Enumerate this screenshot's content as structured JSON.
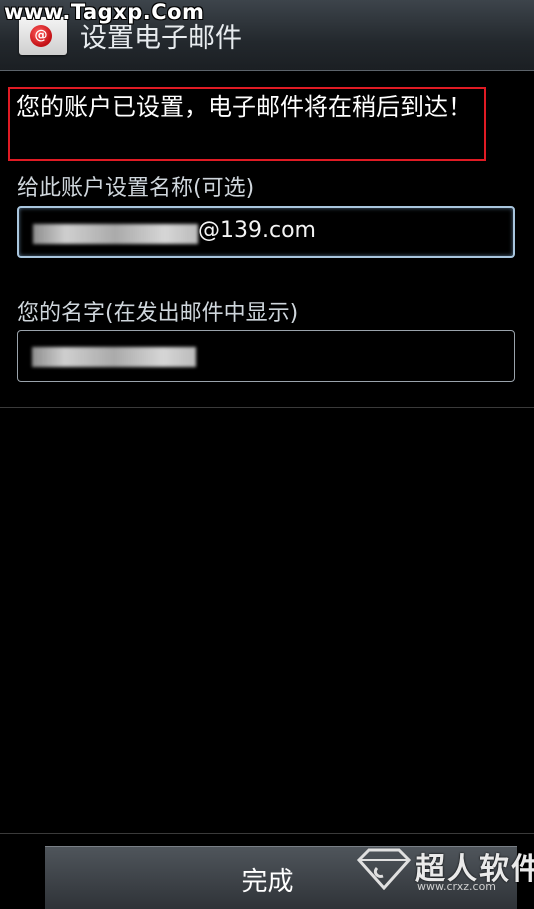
{
  "watermark": {
    "site": "www.Tagxp.Com"
  },
  "header": {
    "title": "设置电子邮件",
    "icon": "email-app-icon"
  },
  "notice": {
    "text": "您的账户已设置，电子邮件将在稍后到达！"
  },
  "fields": [
    {
      "label": "给此账户设置名称(可选)",
      "value": "@139.com",
      "redacted": true
    },
    {
      "label": "您的名字(在发出邮件中显示)",
      "value": "",
      "redacted": true
    }
  ],
  "footer": {
    "done_label": "完成"
  },
  "brand": {
    "name": "超人软件",
    "url": "www.crxz.com"
  },
  "colors": {
    "highlight_border": "#e01b24",
    "focus_border": "#a9c6de",
    "background": "#000000"
  }
}
